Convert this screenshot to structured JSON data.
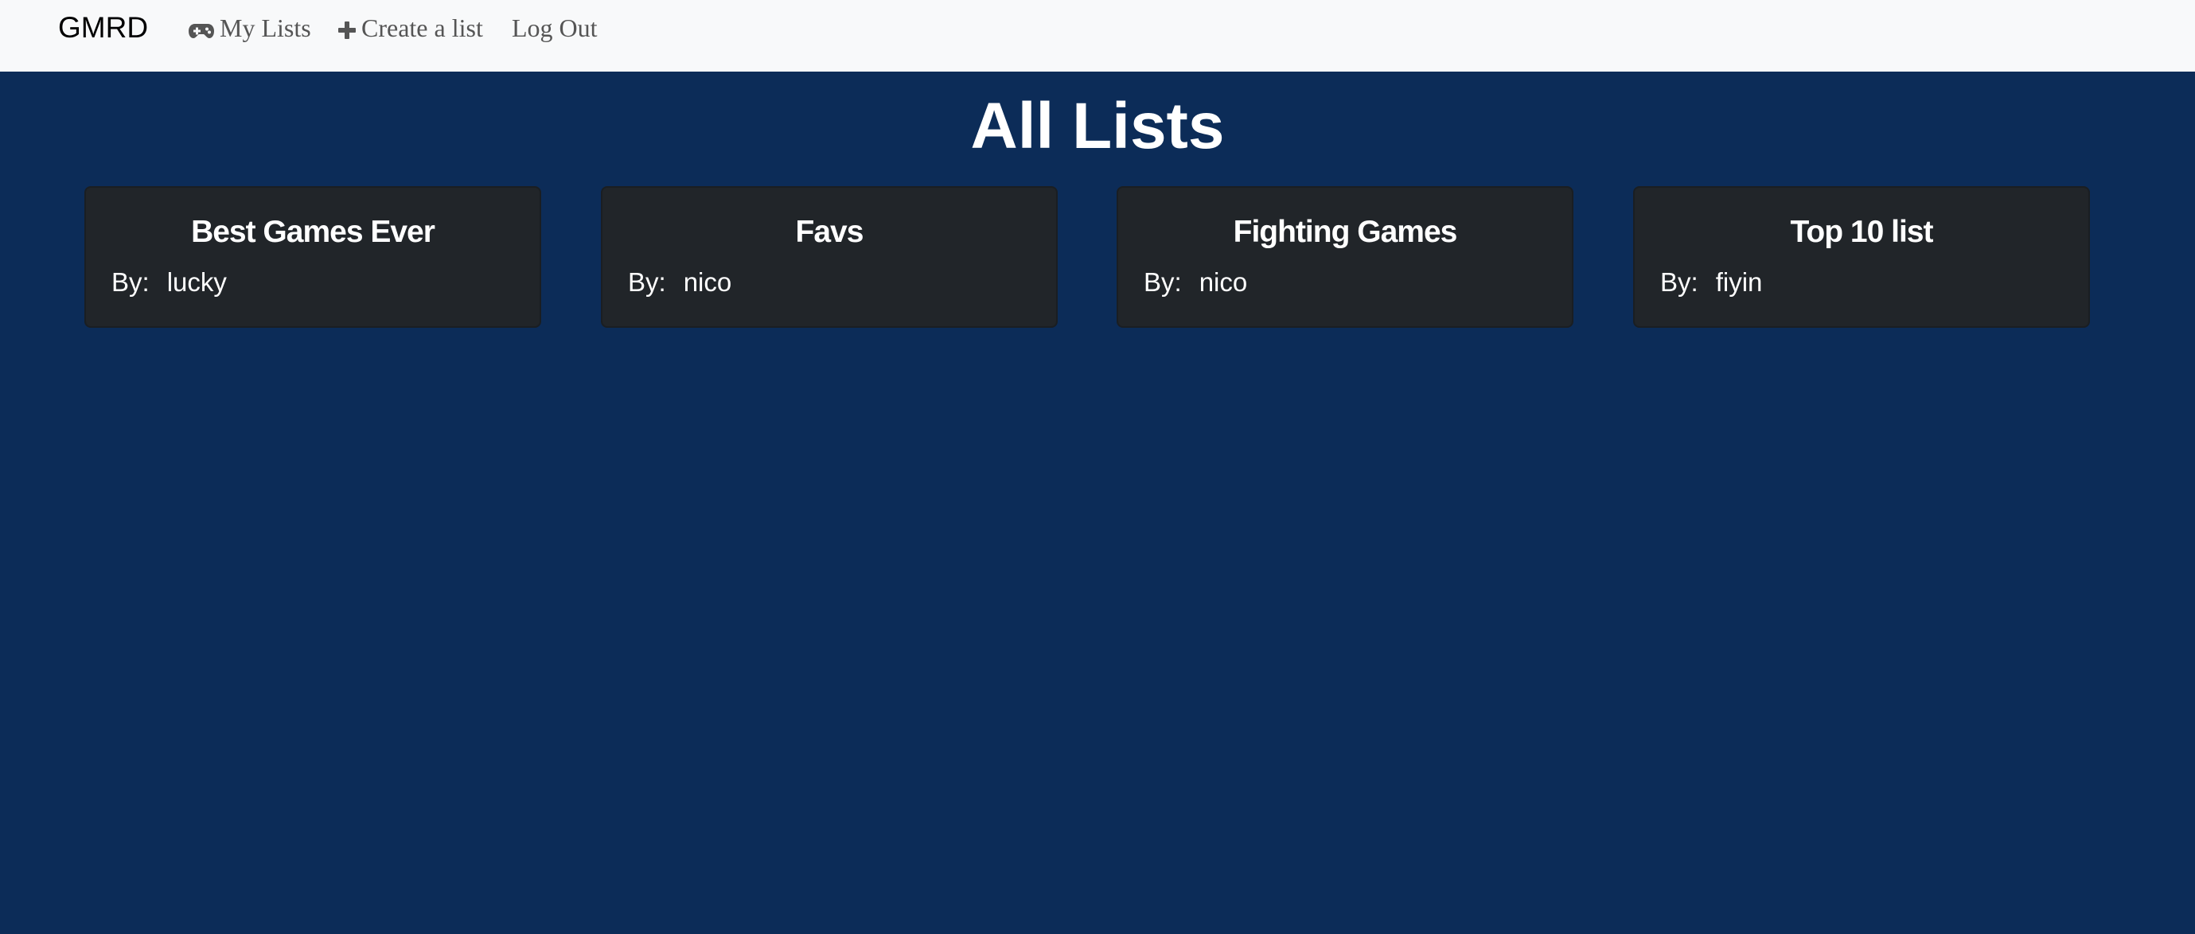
{
  "navbar": {
    "brand": "GMRD",
    "links": [
      {
        "label": "My Lists",
        "icon": "gamepad-icon"
      },
      {
        "label": "Create a list",
        "icon": "plus-icon"
      },
      {
        "label": "Log Out",
        "icon": ""
      }
    ]
  },
  "page": {
    "title": "All Lists"
  },
  "lists": [
    {
      "title": "Best Games Ever",
      "by_label": "By:",
      "author": "lucky"
    },
    {
      "title": "Favs",
      "by_label": "By:",
      "author": "nico"
    },
    {
      "title": "Fighting Games",
      "by_label": "By:",
      "author": "nico"
    },
    {
      "title": "Top 10 list",
      "by_label": "By:",
      "author": "fiyin"
    }
  ],
  "colors": {
    "background": "#0c2c58",
    "navbar": "#f8f9fa",
    "card": "#212529",
    "text": "#ffffff",
    "nav_text": "#555555"
  }
}
